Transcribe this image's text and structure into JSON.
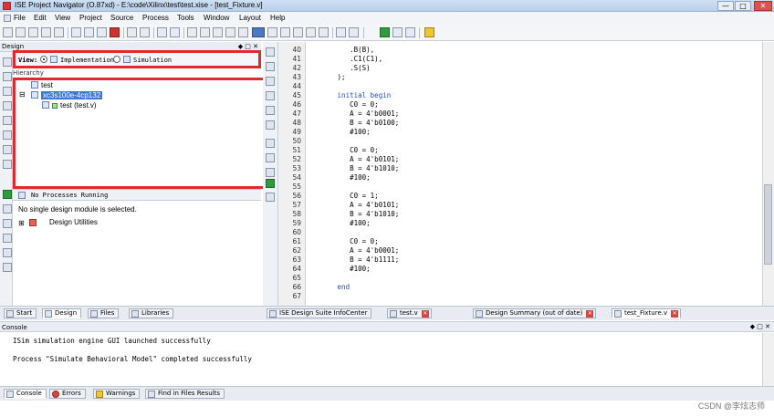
{
  "window": {
    "title": "ISE Project Navigator (O.87xd) - E:\\code\\Xilinx\\test\\test.xise - [test_Fixture.v]",
    "minimize": "—",
    "maximize": "□",
    "close": "✕"
  },
  "menu": [
    "File",
    "Edit",
    "View",
    "Project",
    "Source",
    "Process",
    "Tools",
    "Window",
    "Layout",
    "Help"
  ],
  "design_panel": {
    "header": "Design",
    "header_controls": "◆ □ ✕",
    "view_label": "View:",
    "implementation": "Implementation",
    "simulation": "Simulation",
    "hierarchy_label": "Hierarchy",
    "tree": {
      "root": "test",
      "device": "xc3s100e-4cp132",
      "module": "test (test.v)"
    }
  },
  "processes": {
    "header": "No Processes Running",
    "message": "No single design module is selected.",
    "item": "Design Utilities"
  },
  "left_tabs": [
    "Start",
    "Design",
    "Files",
    "Libraries"
  ],
  "editor": {
    "lines": [
      {
        "n": "40",
        "t": "      .B(B),"
      },
      {
        "n": "41",
        "t": "      .C1(C1),"
      },
      {
        "n": "42",
        "t": "      .S(S)"
      },
      {
        "n": "43",
        "t": "   );"
      },
      {
        "n": "44",
        "t": ""
      },
      {
        "n": "45",
        "t": "   initial begin"
      },
      {
        "n": "46",
        "t": "      C0 = 0;"
      },
      {
        "n": "47",
        "t": "      A = 4'b0001;"
      },
      {
        "n": "48",
        "t": "      B = 4'b0100;"
      },
      {
        "n": "49",
        "t": "      #100;"
      },
      {
        "n": "50",
        "t": ""
      },
      {
        "n": "51",
        "t": "      C0 = 0;"
      },
      {
        "n": "52",
        "t": "      A = 4'b0101;"
      },
      {
        "n": "53",
        "t": "      B = 4'b1010;"
      },
      {
        "n": "54",
        "t": "      #100;"
      },
      {
        "n": "55",
        "t": ""
      },
      {
        "n": "56",
        "t": "      C0 = 1;"
      },
      {
        "n": "57",
        "t": "      A = 4'b0101;"
      },
      {
        "n": "58",
        "t": "      B = 4'b1010;"
      },
      {
        "n": "59",
        "t": "      #100;"
      },
      {
        "n": "60",
        "t": ""
      },
      {
        "n": "61",
        "t": "      C0 = 0;"
      },
      {
        "n": "62",
        "t": "      A = 4'b0001;"
      },
      {
        "n": "63",
        "t": "      B = 4'b1111;"
      },
      {
        "n": "64",
        "t": "      #100;"
      },
      {
        "n": "65",
        "t": ""
      },
      {
        "n": "66",
        "t": "   end"
      },
      {
        "n": "67",
        "t": ""
      }
    ]
  },
  "editor_tabs": [
    "ISE Design Suite InfoCenter",
    "test.v",
    "Design Summary (out of date)",
    "test_Fixture.v"
  ],
  "console": {
    "header": "Console",
    "lines": [
      "ISim simulation engine GUI launched successfully",
      "",
      "Process \"Simulate Behavioral Model\" completed successfully"
    ]
  },
  "console_tabs": [
    "Console",
    "Errors",
    "Warnings",
    "Find in Files Results"
  ],
  "watermark": "CSDN @李炫志师"
}
